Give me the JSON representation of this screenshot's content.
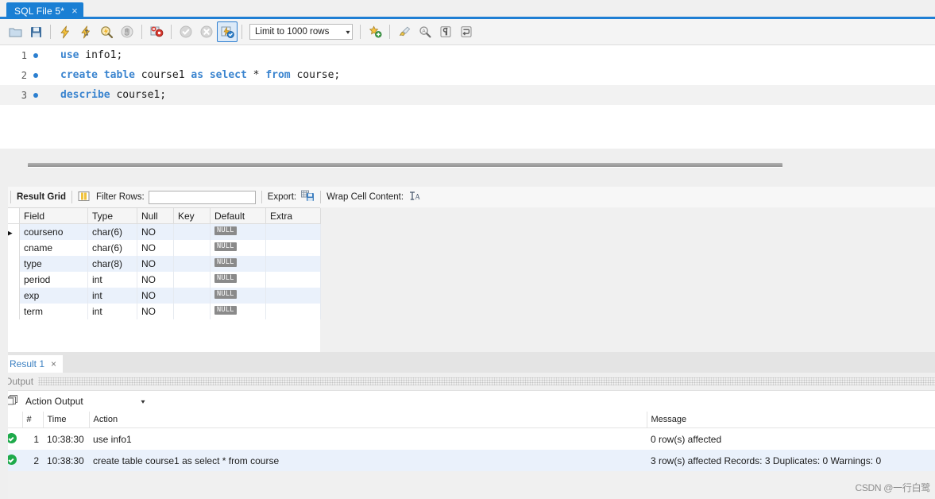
{
  "window": {
    "tab": {
      "label": "SQL File 5*",
      "close": "×"
    }
  },
  "toolbar": {
    "icons": [
      {
        "name": "open-file-icon",
        "glyph": "📁",
        "selected": false
      },
      {
        "name": "save-file-icon",
        "glyph": "💾",
        "selected": false
      },
      {
        "name": "execute-icon",
        "glyph": "⚡",
        "selected": false
      },
      {
        "name": "execute-current-icon",
        "glyph": "⚡",
        "selected": false
      },
      {
        "name": "explain-icon",
        "glyph": "🔍",
        "selected": false
      },
      {
        "name": "stop-icon",
        "glyph": "✋",
        "selected": false
      },
      {
        "name": "toggle-stop-on-error-icon",
        "glyph": "✖",
        "selected": false
      },
      {
        "name": "commit-icon",
        "glyph": "✔",
        "selected": false
      },
      {
        "name": "rollback-icon",
        "glyph": "✖",
        "selected": false
      },
      {
        "name": "autocommit-icon",
        "glyph": "⚡",
        "selected": true
      }
    ],
    "limit_label": "Limit to 1000 rows",
    "limit_caret": "▾",
    "right_icons": [
      {
        "name": "save-snippet-icon",
        "glyph": "★"
      },
      {
        "name": "beautify-sql-icon",
        "glyph": "🧹"
      },
      {
        "name": "find-icon",
        "glyph": "🔍"
      },
      {
        "name": "show-invisible-chars-icon",
        "glyph": "¶"
      },
      {
        "name": "wrap-lines-icon",
        "glyph": "↵"
      }
    ]
  },
  "editor": {
    "lines": [
      {
        "num": "1",
        "tokens": [
          {
            "t": "kw",
            "v": "use"
          },
          {
            "t": "op",
            "v": " info1;"
          }
        ],
        "active": false
      },
      {
        "num": "2",
        "tokens": [
          {
            "t": "kw",
            "v": "create table"
          },
          {
            "t": "op",
            "v": " course1 "
          },
          {
            "t": "kw",
            "v": "as select"
          },
          {
            "t": "op",
            "v": " * "
          },
          {
            "t": "kw",
            "v": "from"
          },
          {
            "t": "op",
            "v": " course;"
          }
        ],
        "active": false
      },
      {
        "num": "3",
        "tokens": [
          {
            "t": "kw",
            "v": "describe"
          },
          {
            "t": "op",
            "v": " course1;"
          }
        ],
        "active": true
      }
    ]
  },
  "grid_toolbar": {
    "result_grid_label": "Result Grid",
    "grid-view-icon": "grid-view-icon",
    "filter_rows_label": "Filter Rows:",
    "filter_value": "",
    "filter_placeholder": "",
    "export_label": "Export:",
    "export-icon": "export-icon",
    "wrap_label": "Wrap Cell Content:",
    "wrap-icon": "wrap-cell-icon"
  },
  "result_grid": {
    "columns": [
      "Field",
      "Type",
      "Null",
      "Key",
      "Default",
      "Extra"
    ],
    "rows": [
      {
        "marker": "▶",
        "field": "courseno",
        "type": "char(6)",
        "null": "NO",
        "key": "",
        "default": "NULL",
        "extra": ""
      },
      {
        "marker": "",
        "field": "cname",
        "type": "char(6)",
        "null": "NO",
        "key": "",
        "default": "NULL",
        "extra": ""
      },
      {
        "marker": "",
        "field": "type",
        "type": "char(8)",
        "null": "NO",
        "key": "",
        "default": "NULL",
        "extra": ""
      },
      {
        "marker": "",
        "field": "period",
        "type": "int",
        "null": "NO",
        "key": "",
        "default": "NULL",
        "extra": ""
      },
      {
        "marker": "",
        "field": "exp",
        "type": "int",
        "null": "NO",
        "key": "",
        "default": "NULL",
        "extra": ""
      },
      {
        "marker": "",
        "field": "term",
        "type": "int",
        "null": "NO",
        "key": "",
        "default": "NULL",
        "extra": ""
      }
    ]
  },
  "result_tabs": [
    {
      "label": "Result 1",
      "close": "×",
      "active": true
    }
  ],
  "output": {
    "panel_label": "Output",
    "selector_label": "Action Output",
    "selector_caret": "▾",
    "selector-icon": "output-panel-icon",
    "columns": [
      "",
      "#",
      "Time",
      "Action",
      "Message"
    ],
    "rows": [
      {
        "status": "success",
        "num": "1",
        "time": "10:38:30",
        "action": "use info1",
        "message": "0 row(s) affected"
      },
      {
        "status": "success",
        "num": "2",
        "time": "10:38:30",
        "action": "create table course1 as select * from course",
        "message": "3 row(s) affected Records: 3  Duplicates: 0  Warnings: 0"
      }
    ]
  },
  "watermark": {
    "text": "CSDN @一行白鹭"
  },
  "colors": {
    "accent": "#1a7fd4",
    "keyword": "#3a84cf",
    "row_alt": "#eaf1fb",
    "success": "#1eaa4b",
    "null_badge": "#8a8a8a"
  }
}
